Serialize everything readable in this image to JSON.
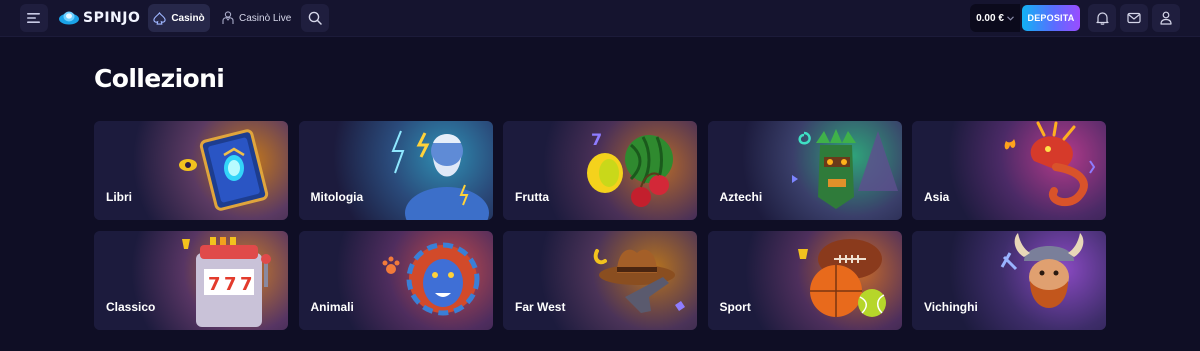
{
  "header": {
    "logo_text": "SPINJO",
    "nav": {
      "casino_label": "Casinò",
      "live_label": "Casinò Live"
    },
    "balance": "0.00 €",
    "deposit_label": "DEPOSITA"
  },
  "page": {
    "title": "Collezioni"
  },
  "collections": [
    {
      "label": "Libri",
      "icon": "book-icon"
    },
    {
      "label": "Mitologia",
      "icon": "zeus-icon"
    },
    {
      "label": "Frutta",
      "icon": "fruit-icon"
    },
    {
      "label": "Aztechi",
      "icon": "aztec-mask-icon"
    },
    {
      "label": "Asia",
      "icon": "dragon-icon"
    },
    {
      "label": "Classico",
      "icon": "slot-machine-icon"
    },
    {
      "label": "Animali",
      "icon": "lion-icon"
    },
    {
      "label": "Far West",
      "icon": "cowboy-hat-icon"
    },
    {
      "label": "Sport",
      "icon": "sport-balls-icon"
    },
    {
      "label": "Vichinghi",
      "icon": "viking-icon"
    }
  ],
  "colors": {
    "background": "#0f0e25",
    "topbar": "#15142f",
    "card": "#1c1b3d",
    "deposit_gradient": [
      "#12b2f4",
      "#5a6dff",
      "#9a4dff"
    ]
  }
}
